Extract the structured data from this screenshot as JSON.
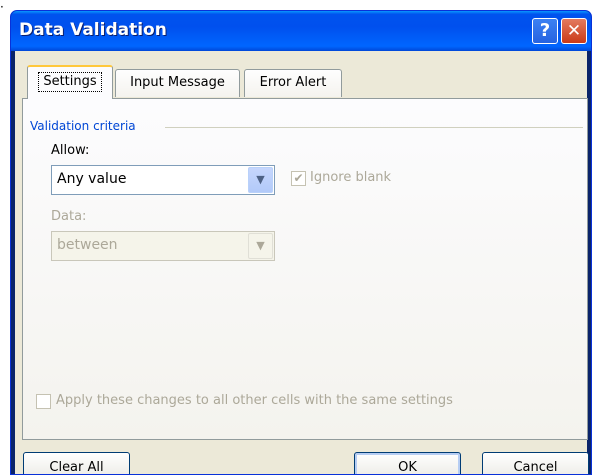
{
  "window": {
    "title": "Data Validation",
    "help_label": "?",
    "close_label": "✕",
    "corner_mark": "·"
  },
  "tabs": [
    {
      "label": "Settings",
      "active": true
    },
    {
      "label": "Input Message",
      "active": false
    },
    {
      "label": "Error Alert",
      "active": false
    }
  ],
  "validation": {
    "section_label": "Validation criteria",
    "allow_label": "Allow:",
    "allow_value": "Any value",
    "ignore_blank_label": "Ignore blank",
    "ignore_blank_checked": true,
    "data_label": "Data:",
    "data_value": "between"
  },
  "apply_all": {
    "label": "Apply these changes to all other cells with the same settings",
    "checked": false
  },
  "buttons": {
    "clear_all": "Clear All",
    "ok": "OK",
    "cancel": "Cancel"
  },
  "icons": {
    "dropdown_arrow": "chevron-down-icon",
    "checkmark": "checkmark-icon"
  },
  "colors": {
    "titlebar": "#0053ee",
    "face": "#ece9d8",
    "group_label": "#0046d5",
    "disabled_text": "#aca899"
  }
}
